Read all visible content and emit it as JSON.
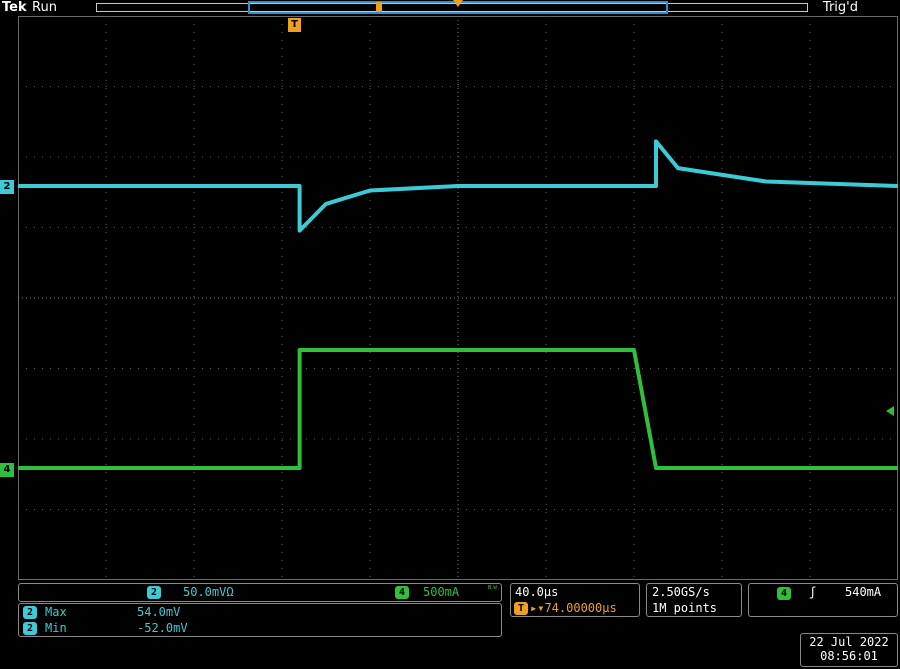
{
  "header": {
    "brand": "Tek",
    "run_state": "Run",
    "trigger_state": "Trig'd",
    "trigger_position_marker": "T"
  },
  "channels": {
    "ch2": {
      "label": "2",
      "color": "#3ccbd6"
    },
    "ch4": {
      "label": "4",
      "color": "#2fbf3a"
    }
  },
  "scale": {
    "ch2_badge": "2",
    "ch2_scale": "50.0mVΩ",
    "ch4_badge": "4",
    "ch4_scale": "500mA"
  },
  "measurements": [
    {
      "badge": "2",
      "name": "Max",
      "value": "54.0mV"
    },
    {
      "badge": "2",
      "name": "Min",
      "value": "-52.0mV"
    }
  ],
  "timebase": {
    "time_per_div": "40.0µs",
    "delay_icon": "T",
    "delay": "▸▾74.00000µs"
  },
  "acquisition": {
    "sample_rate": "2.50GS/s",
    "record_length": "1M points"
  },
  "trigger": {
    "source_badge": "4",
    "slope_icon": "rising-edge-icon",
    "slope_glyph": "ʃ",
    "level": "540mA"
  },
  "datetime": {
    "date": "22 Jul  2022",
    "time": "08:56:01"
  },
  "chart_data": {
    "type": "line",
    "x": [
      -200,
      -140,
      -80,
      -72,
      -60,
      -40,
      0,
      40,
      80,
      90,
      100,
      140,
      200
    ],
    "series": [
      {
        "name": "",
        "values": [
          0,
          0,
          0,
          -50,
          -20,
          -5,
          0,
          0,
          0,
          50,
          20,
          5,
          0
        ]
      },
      {
        "name": "",
        "values": [
          0,
          0,
          0,
          1300,
          1300,
          1300,
          1300,
          1300,
          1300,
          0,
          0,
          0,
          0
        ]
      }
    ],
    "xlim": [
      -200,
      200
    ],
    "grid": true
  }
}
